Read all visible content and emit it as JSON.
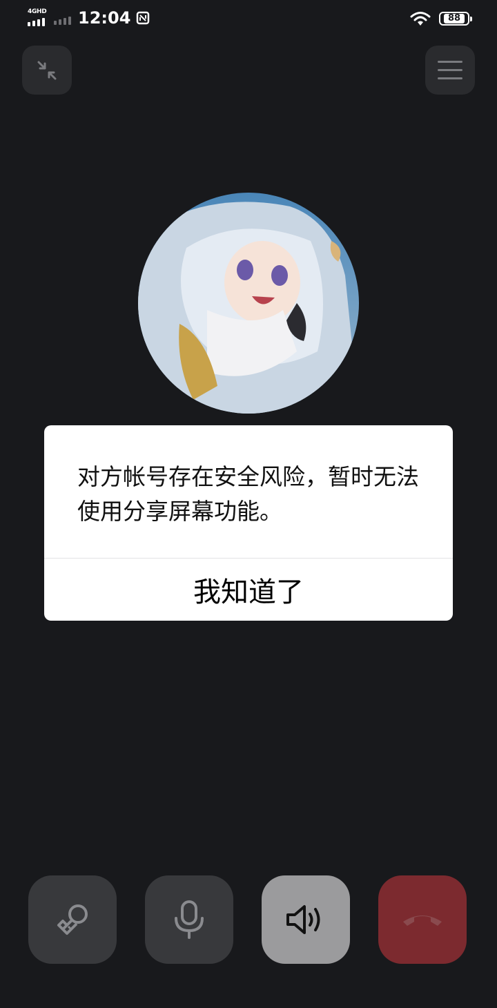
{
  "status_bar": {
    "network_label": "4GHD",
    "time": "12:04",
    "battery": "88"
  },
  "icons": {
    "minimize": "minimize-icon",
    "menu": "menu-icon",
    "screen_share": "screen-share-icon",
    "microphone": "microphone-icon",
    "speaker": "speaker-icon",
    "hang_up": "hang-up-icon"
  },
  "dialog": {
    "message": "对方帐号存在安全风险，暂时无法使用分享屏幕功能。",
    "button_label": "我知道了"
  },
  "colors": {
    "background": "#18191c",
    "hang_up": "#7c2a2f",
    "speaker_active": "#9b9b9d"
  }
}
